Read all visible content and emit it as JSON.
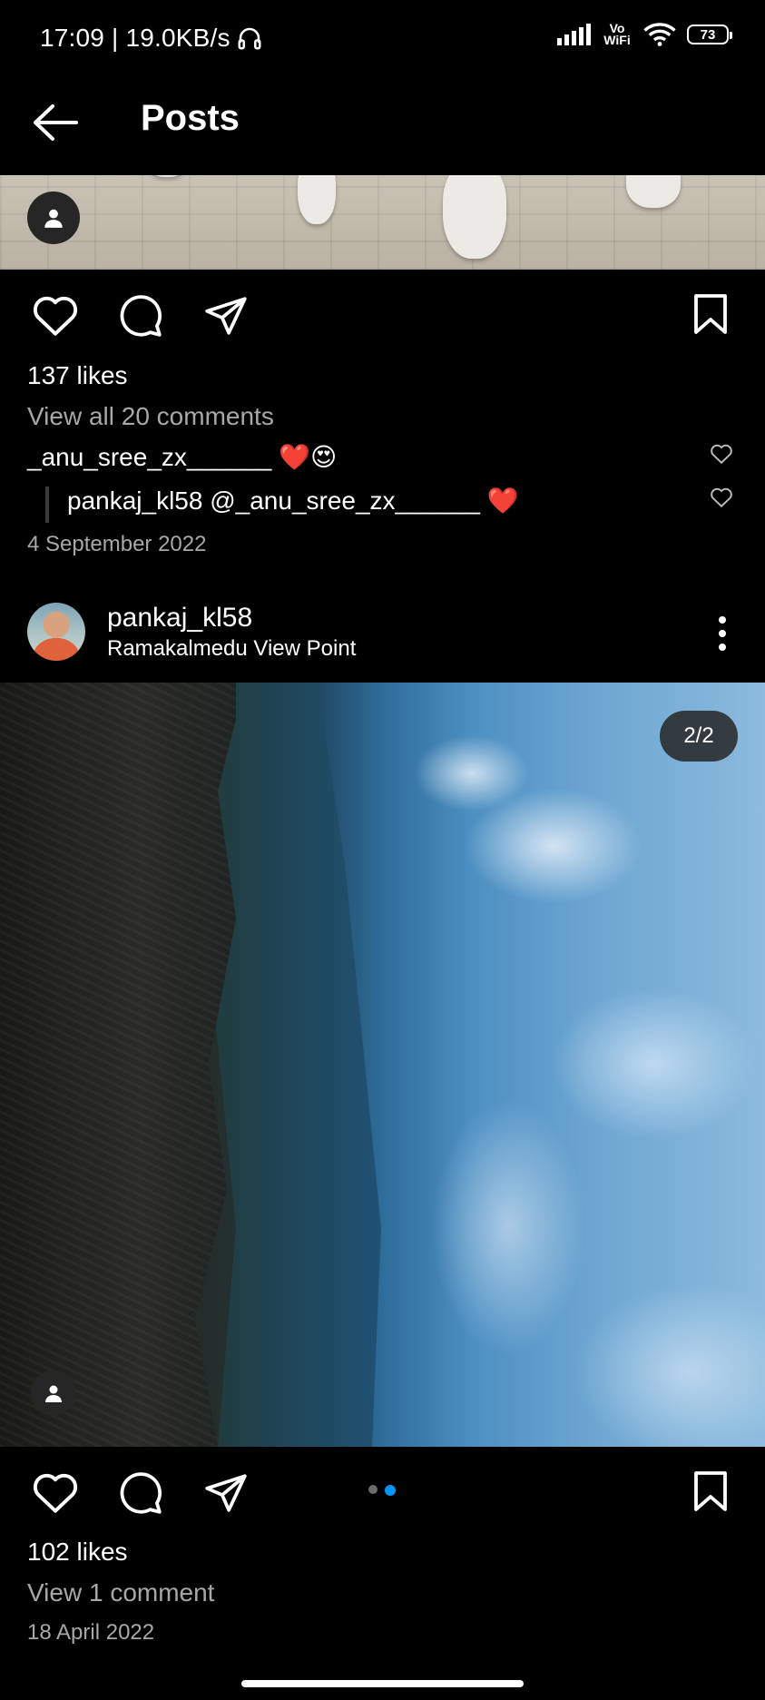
{
  "status_bar": {
    "time_speed": "17:09 | 19.0KB/s",
    "network_label": "Vo WiFi",
    "battery": "73"
  },
  "header": {
    "title": "Posts"
  },
  "post1": {
    "likes": "137 likes",
    "view_comments": "View all 20 comments",
    "comment1": {
      "text": "_anu_sree_zx______ ❤️😍"
    },
    "reply1": {
      "username": "pankaj_kl58",
      "text": " @_anu_sree_zx______ ❤️"
    },
    "date": "4 September 2022"
  },
  "post2": {
    "username": "pankaj_kl58",
    "location": "Ramakalmedu View Point",
    "image_counter": "2/2",
    "carousel": {
      "current": 2,
      "total": 2
    },
    "likes": "102 likes",
    "view_comments": "View 1 comment",
    "date": "18 April 2022"
  },
  "colors": {
    "accent": "#0095f6",
    "background": "#000000",
    "muted": "#a8a8a8"
  }
}
